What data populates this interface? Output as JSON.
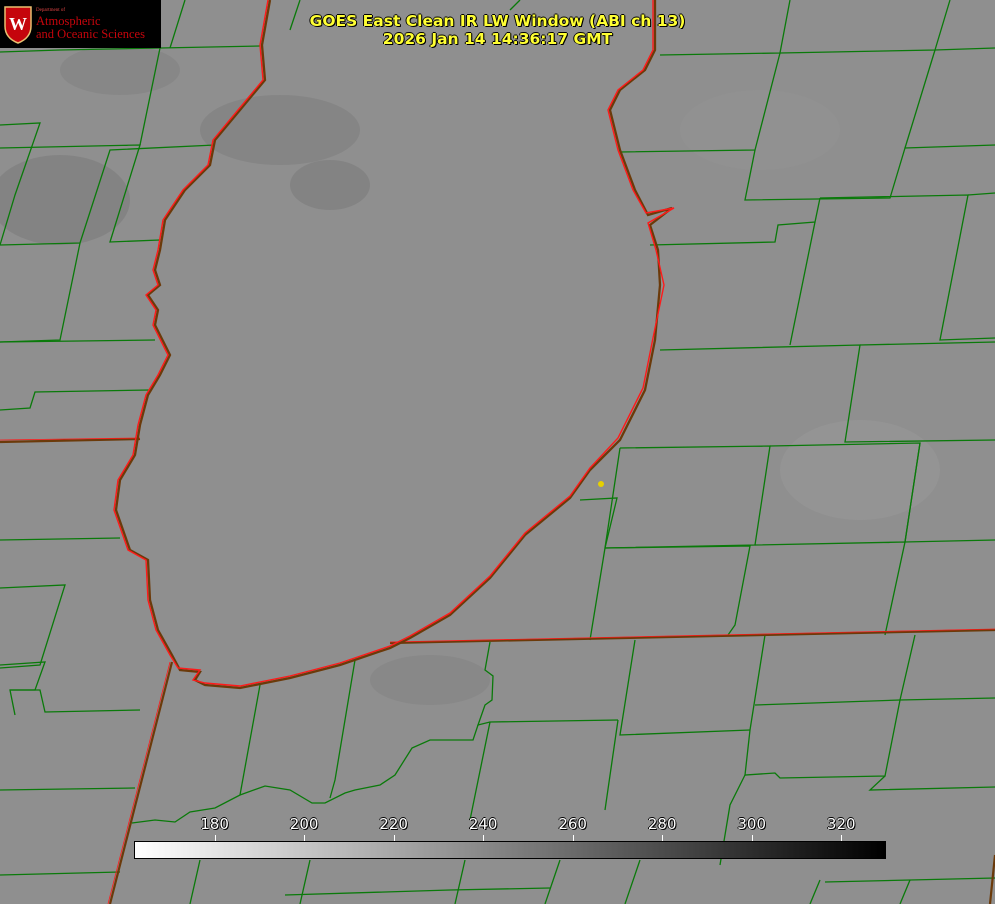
{
  "title_line1": "GOES East Clean IR LW Window (ABI ch 13)",
  "title_line2": "2026 Jan 14 14:36:17 GMT",
  "logo": {
    "dept": "Department of",
    "line1": "Atmospheric",
    "line2": "and Oceanic Sciences",
    "seal_letter": "W",
    "color": "#c5050c"
  },
  "colorbar": {
    "ticks": [
      "180",
      "200",
      "220",
      "240",
      "260",
      "280",
      "300",
      "320"
    ],
    "tick_values": [
      180,
      200,
      220,
      240,
      260,
      280,
      300,
      320
    ],
    "range": [
      162,
      330
    ],
    "low_color": "#ffffff",
    "high_color": "#000000"
  },
  "colors": {
    "county_lines": "#0a7a0a",
    "shoreline_high": "#ff1a1a",
    "shoreline_low": "#6b3a0a",
    "marker": "#e6d000",
    "title_text": "#ffff33"
  }
}
